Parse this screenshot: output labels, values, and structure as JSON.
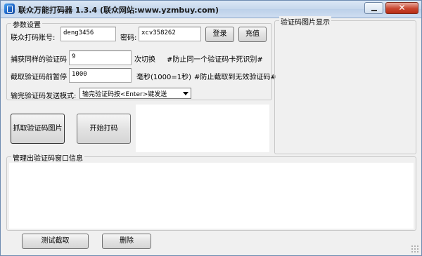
{
  "window": {
    "title": "联众万能打码器 1.3.4 (联众网站:www.yzmbuy.com)",
    "close_glyph": "✕"
  },
  "params": {
    "group_title": "参数设置",
    "account_label": "联众打码账号:",
    "account_value": "deng3456",
    "password_label": "密码:",
    "password_value": "xcv358262",
    "login_button": "登录",
    "recharge_button": "充值",
    "capture_label": "捕获同样的验证码",
    "capture_value": "9",
    "capture_suffix": "次切换",
    "capture_note": "#防止同一个验证码卡死识别#",
    "pause_label": "截取验证码前暂停",
    "pause_value": "1000",
    "pause_suffix": "毫秒(1000=1秒)",
    "pause_note": "#防止截取到无效验证码#",
    "send_mode_label": "输完验证码发送模式:",
    "send_mode_value": "输完验证码按<Enter>键发送"
  },
  "actions": {
    "grab_button": "抓取验证码图片",
    "start_button": "开始打码"
  },
  "preview": {
    "group_title": "验证码图片显示"
  },
  "manage": {
    "group_title": "管理出验证码窗口信息",
    "test_button": "测试截取",
    "delete_button": "删除"
  }
}
